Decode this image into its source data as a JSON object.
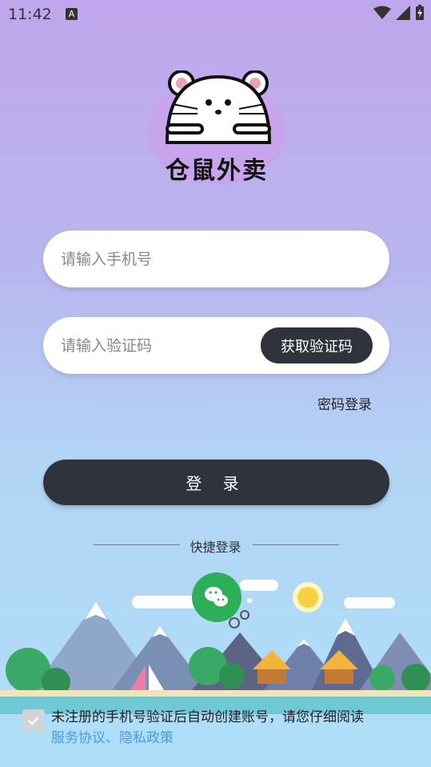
{
  "status_bar": {
    "time": "11:42",
    "notification_letter": "A"
  },
  "logo": {
    "brand_text": "仓鼠外卖"
  },
  "form": {
    "phone_placeholder": "请输入手机号",
    "code_placeholder": "请输入验证码",
    "get_code_label": "获取验证码",
    "password_login_label": "密码登录",
    "login_label": "登 录"
  },
  "quick_login": {
    "label": "快捷登录"
  },
  "agreement": {
    "text": "未注册的手机号验证后自动创建账号，请您仔细阅读",
    "links": "服务协议、隐私政策"
  },
  "colors": {
    "button_dark": "#2f343c",
    "link": "#4a9be0",
    "wechat": "#2dae58"
  }
}
